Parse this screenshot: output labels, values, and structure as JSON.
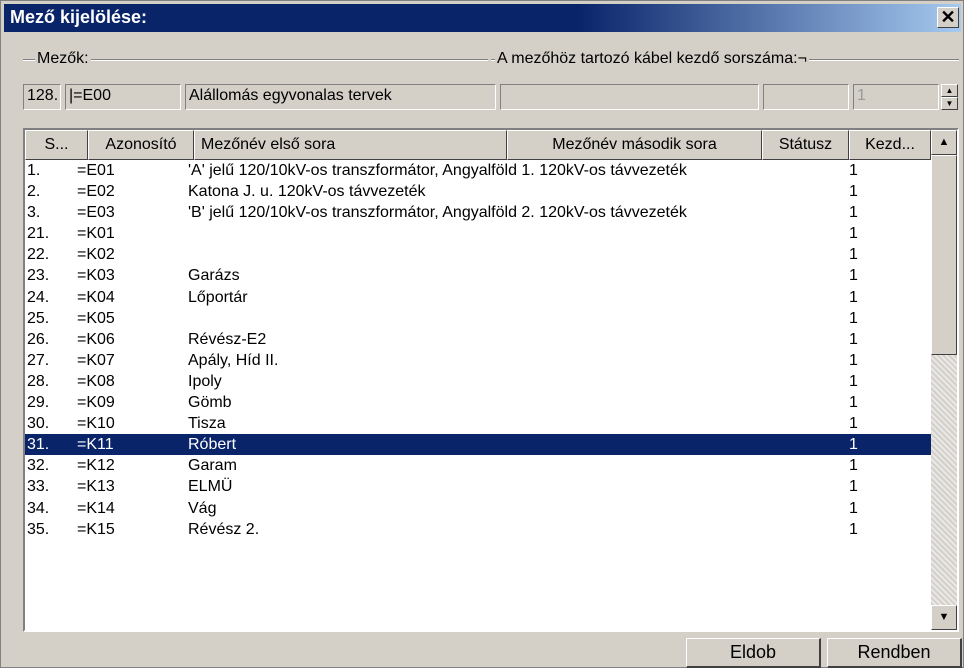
{
  "window": {
    "title": "Mező kijelölése:",
    "close_glyph": "✕"
  },
  "group": {
    "label_left": "Mezők:",
    "label_right": "A mezőhöz tartozó kábel kezdő sorszáma:¬"
  },
  "fields": {
    "number": "128.",
    "id": "|=E00",
    "name": "Alállomás egyvonalas tervek",
    "second": "",
    "status": "",
    "start_value": "1"
  },
  "table": {
    "columns": [
      "S...",
      "Azonosító",
      "Mezőnév első sora",
      "Mezőnév második sora",
      "Státusz",
      "Kezd..."
    ],
    "rows": [
      {
        "s": "1.",
        "id": "=E01",
        "name1": "'A' jelű 120/10kV-os transzformátor, Angyalföld 1. 120kV-os távvezeték",
        "kezd": "1"
      },
      {
        "s": "2.",
        "id": "=E02",
        "name1": "Katona J. u. 120kV-os távvezeték",
        "kezd": "1"
      },
      {
        "s": "3.",
        "id": "=E03",
        "name1": "'B' jelű 120/10kV-os transzformátor, Angyalföld 2. 120kV-os távvezeték",
        "kezd": "1"
      },
      {
        "s": "21.",
        "id": "=K01",
        "name1": "",
        "kezd": "1"
      },
      {
        "s": "22.",
        "id": "=K02",
        "name1": "",
        "kezd": "1"
      },
      {
        "s": "23.",
        "id": "=K03",
        "name1": "Garázs",
        "kezd": "1"
      },
      {
        "s": "24.",
        "id": "=K04",
        "name1": "Lőportár",
        "kezd": "1"
      },
      {
        "s": "25.",
        "id": "=K05",
        "name1": "",
        "kezd": "1"
      },
      {
        "s": "26.",
        "id": "=K06",
        "name1": "Révész-E2",
        "kezd": "1"
      },
      {
        "s": "27.",
        "id": "=K07",
        "name1": "Apály, Híd II.",
        "kezd": "1"
      },
      {
        "s": "28.",
        "id": "=K08",
        "name1": "Ipoly",
        "kezd": "1"
      },
      {
        "s": "29.",
        "id": "=K09",
        "name1": "Gömb",
        "kezd": "1"
      },
      {
        "s": "30.",
        "id": "=K10",
        "name1": "Tisza",
        "kezd": "1"
      },
      {
        "s": "31.",
        "id": "=K11",
        "name1": "Róbert",
        "kezd": "1"
      },
      {
        "s": "32.",
        "id": "=K12",
        "name1": "Garam",
        "kezd": "1"
      },
      {
        "s": "33.",
        "id": "=K13",
        "name1": "ELMÜ",
        "kezd": "1"
      },
      {
        "s": "34.",
        "id": "=K14",
        "name1": "Vág",
        "kezd": "1"
      },
      {
        "s": "35.",
        "id": "=K15",
        "name1": "Révész 2.",
        "kezd": "1"
      }
    ],
    "selected_index": 13
  },
  "buttons": {
    "discard": "Eldob",
    "ok": "Rendben"
  },
  "icons": {
    "close": "close-icon",
    "scroll_up": "triangle-up-icon",
    "scroll_down": "triangle-down-icon"
  },
  "colors": {
    "title_bar": "#0a246a",
    "selection": "#0a246a",
    "face": "#d4d0c8"
  }
}
